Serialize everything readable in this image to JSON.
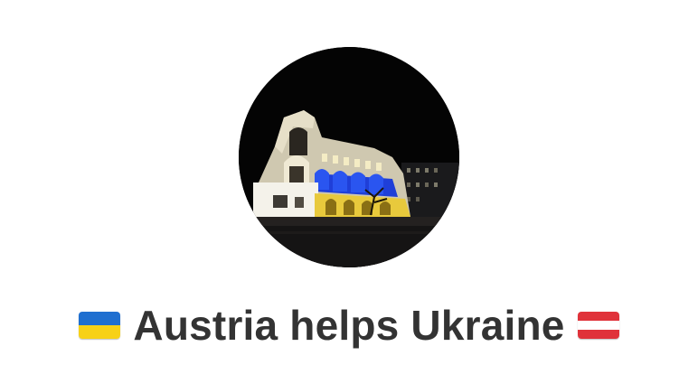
{
  "profile": {
    "title": "Austria helps Ukraine",
    "left_flag": "ukraine-flag",
    "right_flag": "austria-flag",
    "colors": {
      "title_text": "#333333",
      "ukraine_blue": "#1f6fd0",
      "ukraine_yellow": "#f7d117",
      "austria_red": "#e0323a"
    }
  }
}
